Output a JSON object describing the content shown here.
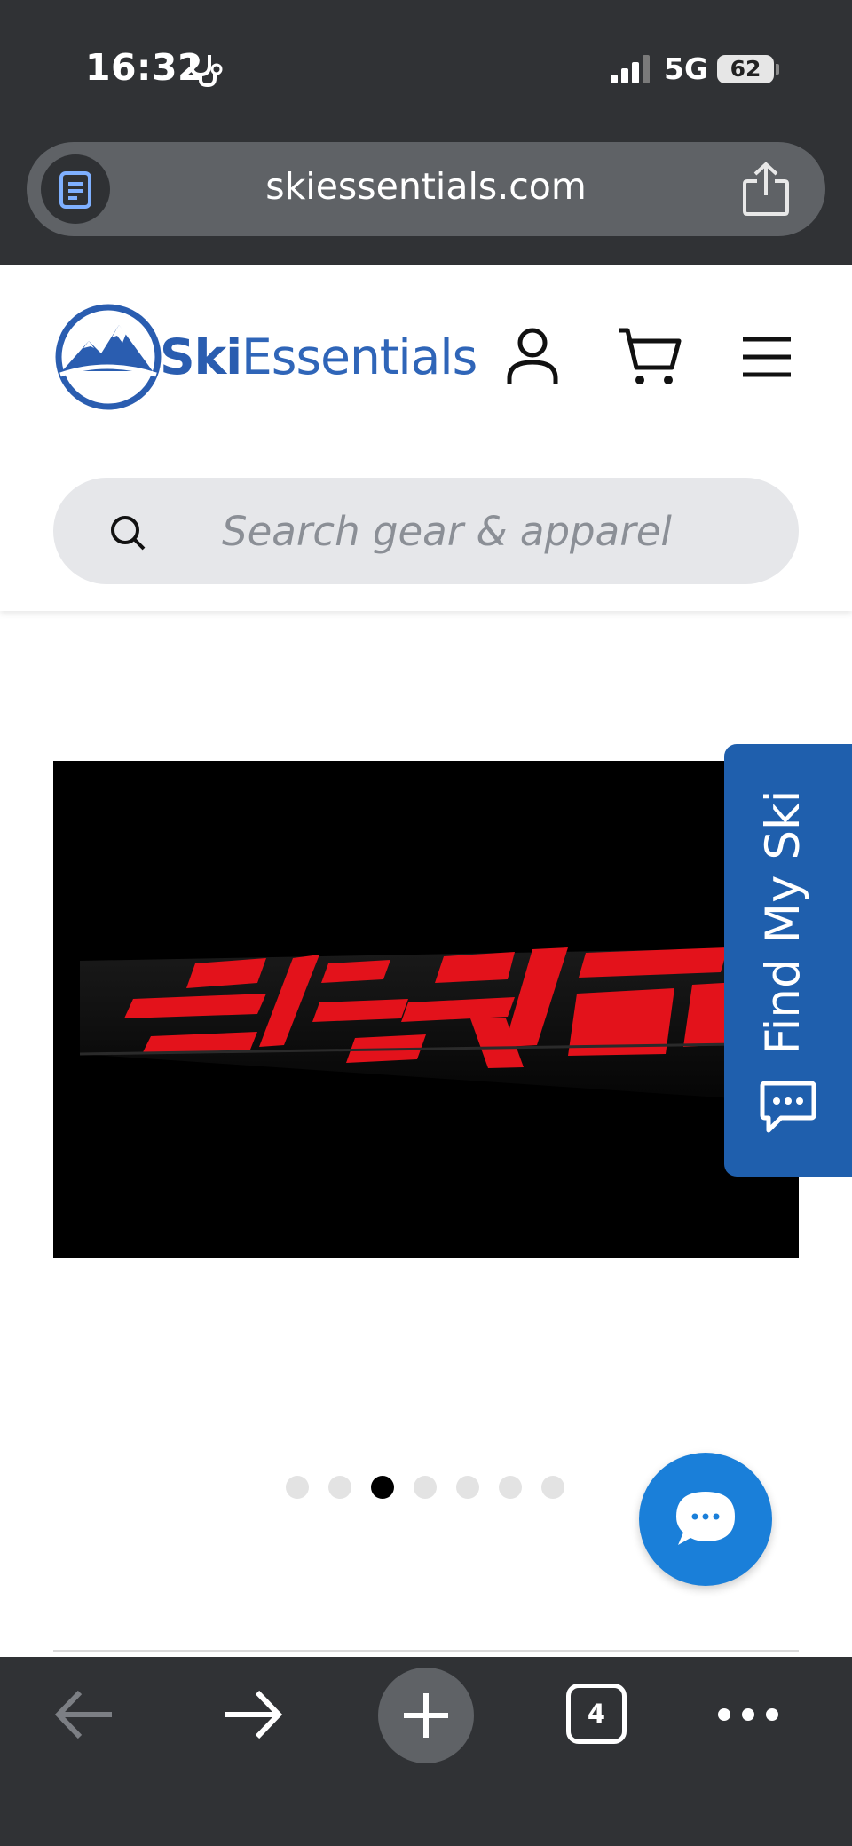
{
  "status_bar": {
    "time": "16:32",
    "network": "5G",
    "battery": "62"
  },
  "browser": {
    "url": "skiessentials.com",
    "tab_count": "4"
  },
  "header": {
    "logo_primary": "Ski",
    "logo_secondary": "Essentials",
    "brand_color": "#2a5db0"
  },
  "search": {
    "placeholder": "Search gear & apparel"
  },
  "carousel": {
    "slide_count": 7,
    "active_index": 2
  },
  "find_my_ski": {
    "label": "Find My Ski",
    "color": "#1f5fad"
  },
  "chat": {
    "color": "#1a7fd9"
  }
}
